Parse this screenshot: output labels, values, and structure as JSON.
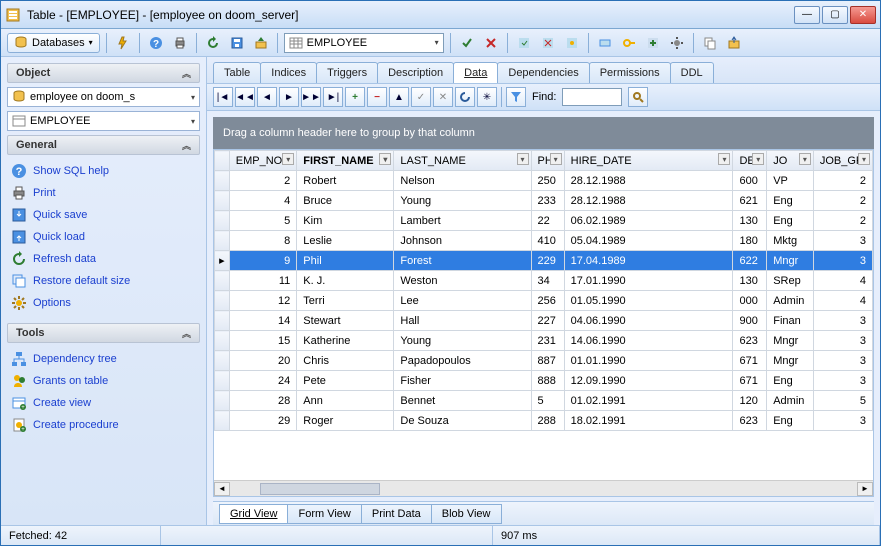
{
  "window": {
    "title": "Table - [EMPLOYEE] - [employee on doom_server]"
  },
  "toolbar": {
    "databases_label": "Databases",
    "table_combo": "EMPLOYEE"
  },
  "sidebar": {
    "object_header": "Object",
    "combo1": "employee on doom_s",
    "combo2": "EMPLOYEE",
    "general_header": "General",
    "general_items": [
      {
        "label": "Show SQL help",
        "icon": "help"
      },
      {
        "label": "Print",
        "icon": "print"
      },
      {
        "label": "Quick save",
        "icon": "qsave"
      },
      {
        "label": "Quick load",
        "icon": "qload"
      },
      {
        "label": "Refresh data",
        "icon": "refresh"
      },
      {
        "label": "Restore default size",
        "icon": "restore"
      },
      {
        "label": "Options",
        "icon": "options"
      }
    ],
    "tools_header": "Tools",
    "tools_items": [
      {
        "label": "Dependency tree",
        "icon": "dep"
      },
      {
        "label": "Grants on table",
        "icon": "grants"
      },
      {
        "label": "Create view",
        "icon": "cview"
      },
      {
        "label": "Create procedure",
        "icon": "cproc"
      }
    ]
  },
  "tabs": {
    "items": [
      "Table",
      "Indices",
      "Triggers",
      "Description",
      "Data",
      "Dependencies",
      "Permissions",
      "DDL"
    ],
    "active": "Data"
  },
  "navtoolbar": {
    "find_label": "Find:"
  },
  "group_header": "Drag a column header here to group by that column",
  "columns": [
    "EMP_NO",
    "FIRST_NAME",
    "LAST_NAME",
    "PH",
    "HIRE_DATE",
    "DE",
    "JO",
    "JOB_GR"
  ],
  "col_display": [
    "EMP_NO",
    "FIRST_NAME",
    "LAST_NAME",
    "PH",
    "HIRE_DATE",
    "DE",
    "JO",
    "JOB_GF"
  ],
  "sorted_col": "FIRST_NAME",
  "rows": [
    {
      "EMP_NO": 2,
      "FIRST_NAME": "Robert",
      "LAST_NAME": "Nelson",
      "PH": "250",
      "HIRE_DATE": "28.12.1988",
      "DE": "600",
      "JO": "VP",
      "JOB_GR": 2
    },
    {
      "EMP_NO": 4,
      "FIRST_NAME": "Bruce",
      "LAST_NAME": "Young",
      "PH": "233",
      "HIRE_DATE": "28.12.1988",
      "DE": "621",
      "JO": "Eng",
      "JOB_GR": 2
    },
    {
      "EMP_NO": 5,
      "FIRST_NAME": "Kim",
      "LAST_NAME": "Lambert",
      "PH": "22",
      "HIRE_DATE": "06.02.1989",
      "DE": "130",
      "JO": "Eng",
      "JOB_GR": 2
    },
    {
      "EMP_NO": 8,
      "FIRST_NAME": "Leslie",
      "LAST_NAME": "Johnson",
      "PH": "410",
      "HIRE_DATE": "05.04.1989",
      "DE": "180",
      "JO": "Mktg",
      "JOB_GR": 3
    },
    {
      "EMP_NO": 9,
      "FIRST_NAME": "Phil",
      "LAST_NAME": "Forest",
      "PH": "229",
      "HIRE_DATE": "17.04.1989",
      "DE": "622",
      "JO": "Mngr",
      "JOB_GR": 3,
      "selected": true
    },
    {
      "EMP_NO": 11,
      "FIRST_NAME": "K. J.",
      "LAST_NAME": "Weston",
      "PH": "34",
      "HIRE_DATE": "17.01.1990",
      "DE": "130",
      "JO": "SRep",
      "JOB_GR": 4
    },
    {
      "EMP_NO": 12,
      "FIRST_NAME": "Terri",
      "LAST_NAME": "Lee",
      "PH": "256",
      "HIRE_DATE": "01.05.1990",
      "DE": "000",
      "JO": "Admin",
      "JOB_GR": 4
    },
    {
      "EMP_NO": 14,
      "FIRST_NAME": "Stewart",
      "LAST_NAME": "Hall",
      "PH": "227",
      "HIRE_DATE": "04.06.1990",
      "DE": "900",
      "JO": "Finan",
      "JOB_GR": 3
    },
    {
      "EMP_NO": 15,
      "FIRST_NAME": "Katherine",
      "LAST_NAME": "Young",
      "PH": "231",
      "HIRE_DATE": "14.06.1990",
      "DE": "623",
      "JO": "Mngr",
      "JOB_GR": 3
    },
    {
      "EMP_NO": 20,
      "FIRST_NAME": "Chris",
      "LAST_NAME": "Papadopoulos",
      "PH": "887",
      "HIRE_DATE": "01.01.1990",
      "DE": "671",
      "JO": "Mngr",
      "JOB_GR": 3
    },
    {
      "EMP_NO": 24,
      "FIRST_NAME": "Pete",
      "LAST_NAME": "Fisher",
      "PH": "888",
      "HIRE_DATE": "12.09.1990",
      "DE": "671",
      "JO": "Eng",
      "JOB_GR": 3
    },
    {
      "EMP_NO": 28,
      "FIRST_NAME": "Ann",
      "LAST_NAME": "Bennet",
      "PH": "5",
      "HIRE_DATE": "01.02.1991",
      "DE": "120",
      "JO": "Admin",
      "JOB_GR": 5
    },
    {
      "EMP_NO": 29,
      "FIRST_NAME": "Roger",
      "LAST_NAME": "De Souza",
      "PH": "288",
      "HIRE_DATE": "18.02.1991",
      "DE": "623",
      "JO": "Eng",
      "JOB_GR": 3
    }
  ],
  "view_tabs": {
    "items": [
      "Grid View",
      "Form View",
      "Print Data",
      "Blob View"
    ],
    "active": "Grid View"
  },
  "status": {
    "fetched": "Fetched: 42",
    "ms": "907 ms"
  },
  "colors": {
    "selection": "#2f7de1",
    "link": "#1a3fcf"
  }
}
